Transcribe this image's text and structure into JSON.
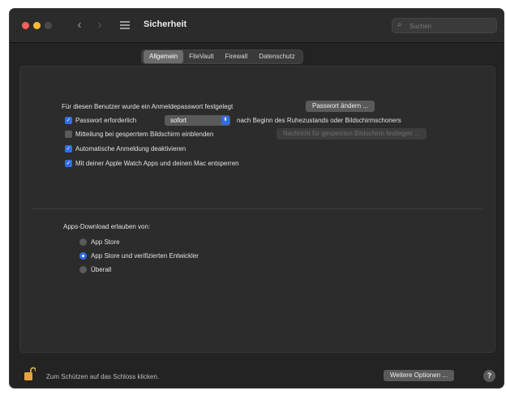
{
  "titlebar": {
    "title": "Sicherheit",
    "back_glyph": "‹",
    "forward_glyph": "›",
    "search_placeholder": "Suchen",
    "search_icon": "⌕"
  },
  "tabs": [
    {
      "label": "Allgemein",
      "active": true
    },
    {
      "label": "FileVault",
      "active": false
    },
    {
      "label": "Firewall",
      "active": false
    },
    {
      "label": "Datenschutz",
      "active": false
    }
  ],
  "general": {
    "login_password_text": "Für diesen Benutzer wurde ein Anmeldepasswort festgelegt",
    "change_password_button": "Passwort ändern ...",
    "require_password_label": "Passwort erforderlich",
    "require_password_checked": true,
    "require_password_select_value": "sofort",
    "require_password_suffix": "nach Beginn des Ruhezustands oder Bildschirmschoners",
    "lock_message_label": "Mitteilung bei gesperrtem Bildschirm einblenden",
    "lock_message_checked": false,
    "lock_message_button": "Nachricht für gesperrten Bildschirm festlegen ...",
    "disable_auto_login_label": "Automatische Anmeldung deaktivieren",
    "disable_auto_login_checked": true,
    "apple_watch_label": "Mit deiner Apple Watch Apps und deinen Mac entsperren",
    "apple_watch_checked": true
  },
  "downloads": {
    "heading": "Apps-Download erlauben von:",
    "options": [
      {
        "label": "App Store",
        "selected": false
      },
      {
        "label": "App Store und verifizierten Entwickler",
        "selected": true
      },
      {
        "label": "Überall",
        "selected": false
      }
    ]
  },
  "footer": {
    "lock_text": "Zum Schützen auf das Schloss klicken.",
    "advanced_button": "Weitere Optionen ...",
    "help_glyph": "?"
  },
  "colors": {
    "accent": "#2f6fe4",
    "window_bg": "#232323",
    "panel_bg": "#2c2c2c",
    "lock_color": "#e8a23b"
  },
  "icons": {
    "lock": "lock-open-icon",
    "search": "search-icon",
    "grid": "grid-icon",
    "help": "help-icon"
  }
}
